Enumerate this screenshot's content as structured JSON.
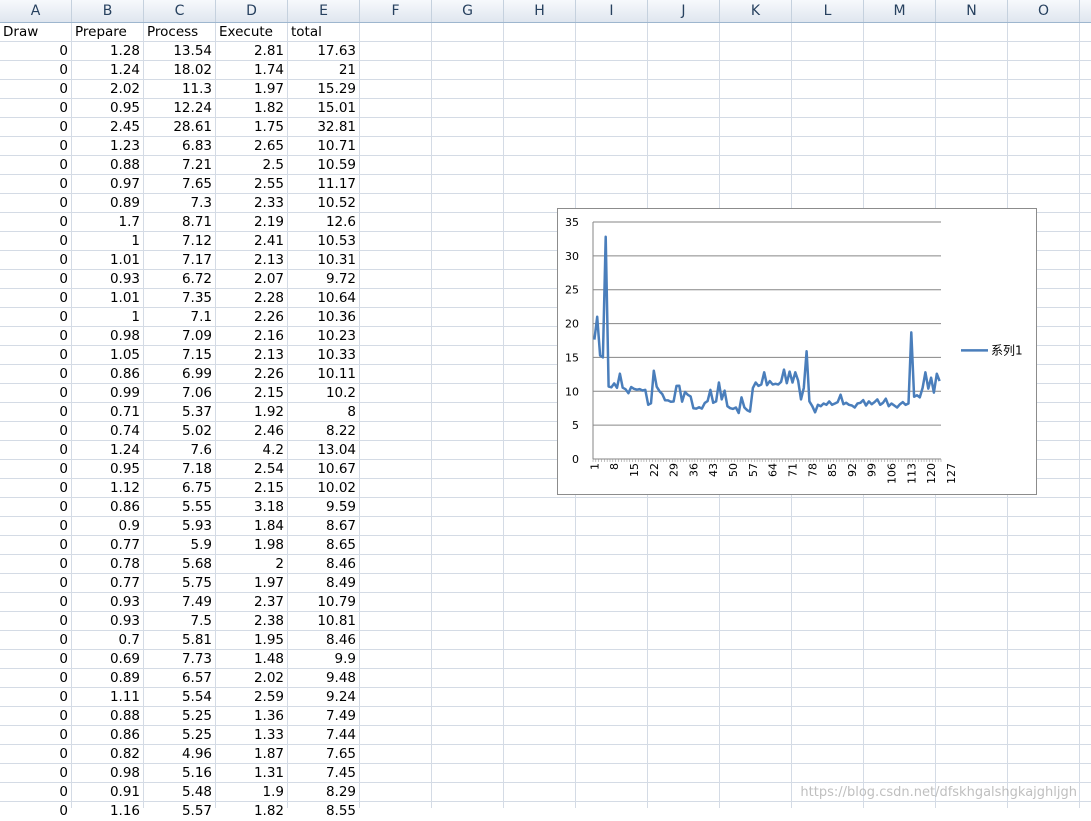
{
  "spreadsheet": {
    "column_headers": [
      "A",
      "B",
      "C",
      "D",
      "E",
      "F",
      "G",
      "H",
      "I",
      "J",
      "K",
      "L",
      "M",
      "N",
      "O"
    ],
    "header_row": [
      "Draw",
      "Prepare",
      "Process",
      "Execute",
      "total"
    ],
    "rows": [
      [
        "0",
        "1.28",
        "13.54",
        "2.81",
        "17.63"
      ],
      [
        "0",
        "1.24",
        "18.02",
        "1.74",
        "21"
      ],
      [
        "0",
        "2.02",
        "11.3",
        "1.97",
        "15.29"
      ],
      [
        "0",
        "0.95",
        "12.24",
        "1.82",
        "15.01"
      ],
      [
        "0",
        "2.45",
        "28.61",
        "1.75",
        "32.81"
      ],
      [
        "0",
        "1.23",
        "6.83",
        "2.65",
        "10.71"
      ],
      [
        "0",
        "0.88",
        "7.21",
        "2.5",
        "10.59"
      ],
      [
        "0",
        "0.97",
        "7.65",
        "2.55",
        "11.17"
      ],
      [
        "0",
        "0.89",
        "7.3",
        "2.33",
        "10.52"
      ],
      [
        "0",
        "1.7",
        "8.71",
        "2.19",
        "12.6"
      ],
      [
        "0",
        "1",
        "7.12",
        "2.41",
        "10.53"
      ],
      [
        "0",
        "1.01",
        "7.17",
        "2.13",
        "10.31"
      ],
      [
        "0",
        "0.93",
        "6.72",
        "2.07",
        "9.72"
      ],
      [
        "0",
        "1.01",
        "7.35",
        "2.28",
        "10.64"
      ],
      [
        "0",
        "1",
        "7.1",
        "2.26",
        "10.36"
      ],
      [
        "0",
        "0.98",
        "7.09",
        "2.16",
        "10.23"
      ],
      [
        "0",
        "1.05",
        "7.15",
        "2.13",
        "10.33"
      ],
      [
        "0",
        "0.86",
        "6.99",
        "2.26",
        "10.11"
      ],
      [
        "0",
        "0.99",
        "7.06",
        "2.15",
        "10.2"
      ],
      [
        "0",
        "0.71",
        "5.37",
        "1.92",
        "8"
      ],
      [
        "0",
        "0.74",
        "5.02",
        "2.46",
        "8.22"
      ],
      [
        "0",
        "1.24",
        "7.6",
        "4.2",
        "13.04"
      ],
      [
        "0",
        "0.95",
        "7.18",
        "2.54",
        "10.67"
      ],
      [
        "0",
        "1.12",
        "6.75",
        "2.15",
        "10.02"
      ],
      [
        "0",
        "0.86",
        "5.55",
        "3.18",
        "9.59"
      ],
      [
        "0",
        "0.9",
        "5.93",
        "1.84",
        "8.67"
      ],
      [
        "0",
        "0.77",
        "5.9",
        "1.98",
        "8.65"
      ],
      [
        "0",
        "0.78",
        "5.68",
        "2",
        "8.46"
      ],
      [
        "0",
        "0.77",
        "5.75",
        "1.97",
        "8.49"
      ],
      [
        "0",
        "0.93",
        "7.49",
        "2.37",
        "10.79"
      ],
      [
        "0",
        "0.93",
        "7.5",
        "2.38",
        "10.81"
      ],
      [
        "0",
        "0.7",
        "5.81",
        "1.95",
        "8.46"
      ],
      [
        "0",
        "0.69",
        "7.73",
        "1.48",
        "9.9"
      ],
      [
        "0",
        "0.89",
        "6.57",
        "2.02",
        "9.48"
      ],
      [
        "0",
        "1.11",
        "5.54",
        "2.59",
        "9.24"
      ],
      [
        "0",
        "0.88",
        "5.25",
        "1.36",
        "7.49"
      ],
      [
        "0",
        "0.86",
        "5.25",
        "1.33",
        "7.44"
      ],
      [
        "0",
        "0.82",
        "4.96",
        "1.87",
        "7.65"
      ],
      [
        "0",
        "0.98",
        "5.16",
        "1.31",
        "7.45"
      ],
      [
        "0",
        "0.91",
        "5.48",
        "1.9",
        "8.29"
      ],
      [
        "0",
        "1.16",
        "5.57",
        "1.82",
        "8.55"
      ]
    ]
  },
  "chart_data": {
    "type": "line",
    "title": "",
    "xlabel": "",
    "ylabel": "",
    "ylim": [
      0,
      35
    ],
    "yticks": [
      "0",
      "5",
      "10",
      "15",
      "20",
      "25",
      "30",
      "35"
    ],
    "xtick_labels": [
      "1",
      "8",
      "15",
      "22",
      "29",
      "36",
      "43",
      "50",
      "57",
      "64",
      "71",
      "78",
      "85",
      "92",
      "99",
      "106",
      "113",
      "120",
      "127"
    ],
    "grid": true,
    "legend_position": "right",
    "series": [
      {
        "name": "系列1",
        "color": "#4a7ebb",
        "values": [
          17.63,
          21,
          15.29,
          15.01,
          32.81,
          10.71,
          10.59,
          11.17,
          10.52,
          12.6,
          10.53,
          10.31,
          9.72,
          10.64,
          10.36,
          10.23,
          10.33,
          10.11,
          10.2,
          8,
          8.22,
          13.04,
          10.67,
          10.02,
          9.59,
          8.67,
          8.65,
          8.46,
          8.49,
          10.79,
          10.81,
          8.46,
          9.9,
          9.48,
          9.24,
          7.49,
          7.44,
          7.65,
          7.45,
          8.29,
          8.55,
          10.2,
          8.3,
          8.5,
          11.3,
          8.8,
          10.1,
          7.8,
          7.5,
          7.4,
          7.6,
          6.8,
          9.1,
          7.6,
          7.2,
          7.0,
          10.5,
          11.3,
          10.8,
          11.0,
          12.8,
          10.9,
          11.5,
          11.0,
          11.1,
          11.0,
          11.4,
          13.2,
          11.2,
          12.9,
          11.3,
          12.8,
          11.6,
          8.8,
          10.5,
          15.9,
          8.5,
          7.8,
          6.9,
          8.0,
          7.8,
          8.2,
          8.0,
          8.5,
          8.0,
          8.2,
          8.4,
          9.5,
          8.1,
          8.3,
          8.0,
          7.9,
          7.6,
          8.2,
          8.3,
          8.7,
          7.9,
          8.5,
          8.1,
          8.4,
          8.8,
          8.0,
          8.3,
          8.9,
          7.8,
          8.2,
          7.9,
          7.6,
          8.1,
          8.4,
          8.0,
          8.2,
          18.7,
          9.2,
          9.4,
          9.1,
          10.5,
          12.8,
          10.4,
          12.0,
          9.8,
          12.6,
          11.5
        ]
      }
    ]
  },
  "watermark": "https://blog.csdn.net/dfskhgalshgkajghljgh"
}
